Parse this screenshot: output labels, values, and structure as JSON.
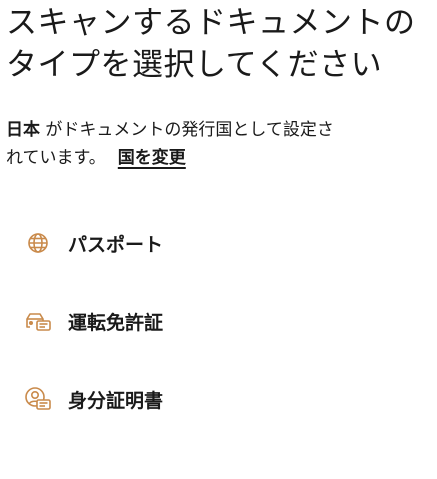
{
  "header": {
    "title_line1": "スキャンするドキュメントの",
    "title_line2": "タイプを選択してください"
  },
  "issuer": {
    "country": "日本",
    "text_line1": " がドキュメントの発行国として設定さ",
    "text_line2": "れています。",
    "change_link": "国を変更"
  },
  "options": [
    {
      "label": "パスポート",
      "icon": "globe-icon"
    },
    {
      "label": "運転免許証",
      "icon": "car-card-icon"
    },
    {
      "label": "身分証明書",
      "icon": "person-card-icon"
    }
  ],
  "colors": {
    "accent": "#c98a4b",
    "text": "#1a1a1a",
    "background": "#ffffff"
  }
}
